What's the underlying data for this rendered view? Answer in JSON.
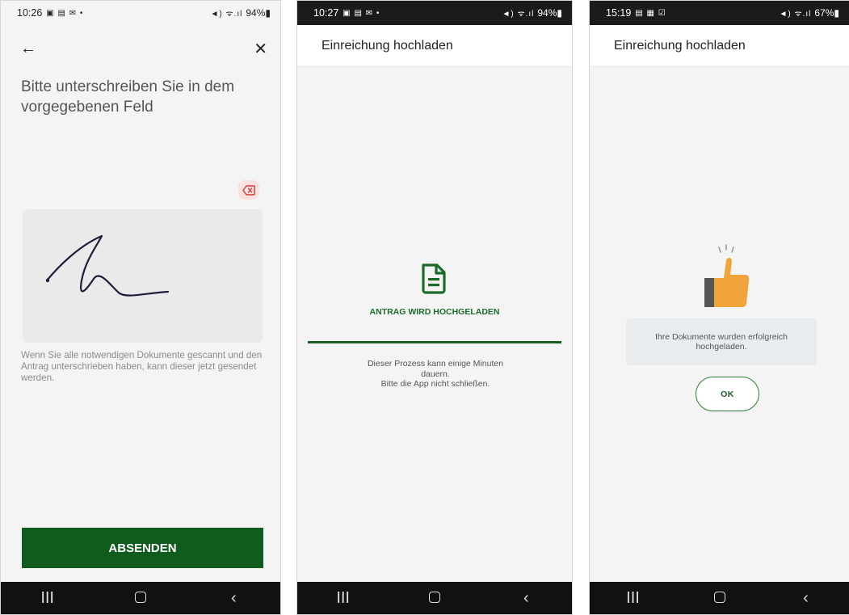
{
  "screen1": {
    "status": {
      "time": "10:26",
      "notif_icons": "▣ ▤ ✉ •",
      "signal_icons": "◄) ᯤ.ıl",
      "battery": "94%▮"
    },
    "title": "Bitte unterschreiben Sie in dem vorgegebenen Feld",
    "hint": "Wenn Sie alle notwendigen Dokumente gescannt und den Antrag unterschrieben haben, kann dieser jetzt gesendet werden.",
    "submit_label": "ABSENDEN",
    "back_icon": "←",
    "close_icon": "✕"
  },
  "screen2": {
    "status": {
      "time": "10:27",
      "notif_icons": "▣ ▤ ✉ •",
      "signal_icons": "◄) ᯤ.ıl",
      "battery": "94%▮"
    },
    "header_title": "Einreichung hochladen",
    "upload_status": "ANTRAG WIRD HOCHGELADEN",
    "progress": 1.0,
    "note_line1": "Dieser Prozess kann einige Minuten",
    "note_line2": "dauern.",
    "note_line3": "Bitte die App nicht schließen."
  },
  "screen3": {
    "status": {
      "time": "15:19",
      "notif_icons": "▤ ▦ ☑",
      "signal_icons": "◄) ᯤ.ıl",
      "battery": "67%▮"
    },
    "header_title": "Einreichung hochladen",
    "success_message": "Ihre Dokumente wurden erfolgreich hochgeladen.",
    "ok_label": "OK"
  },
  "nav": {
    "recent": "III",
    "back": "‹"
  },
  "colors": {
    "primary": "#0f5c1e",
    "accent_text": "#1b6b2a",
    "thumb": "#f0a43a",
    "cuff": "#555555",
    "clear_icon": "#d03a3a"
  }
}
